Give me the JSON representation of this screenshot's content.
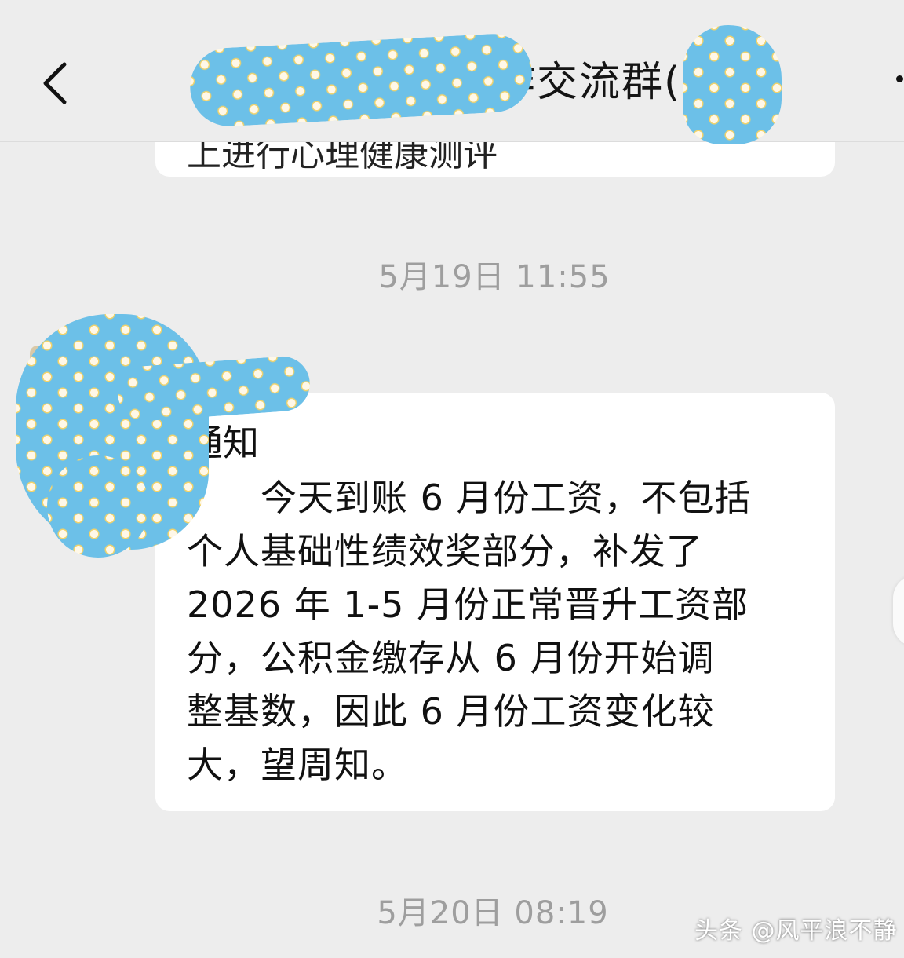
{
  "header": {
    "title_visible": "作交流群(",
    "back_icon": "chevron-left-icon",
    "more_icon": "more-vertical-icon"
  },
  "messages": {
    "previous_bubble_partial": "上进行心理健康测评",
    "timestamp_1": "5月19日 11:55",
    "notice": {
      "title": "通知",
      "lines": [
        "　　今天到账 6 月份工资，不包括",
        "个人基础性绩效奖部分，补发了",
        "2026 年 1-5 月份正常晋升工资部",
        "分，公积金缴存从 6 月份开始调",
        "整基数，因此 6 月份工资变化较",
        "大，望周知。"
      ]
    },
    "timestamp_2": "5月20日 08:19"
  },
  "watermark": "头条 @风平浪不静",
  "colors": {
    "background": "#ededed",
    "bubble": "#ffffff",
    "timestamp": "#9e9e9e",
    "redaction": "#6cc0e8"
  }
}
